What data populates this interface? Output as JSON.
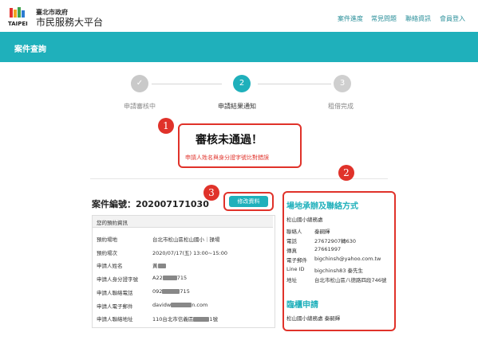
{
  "header": {
    "brand_small": "臺北市政府",
    "brand_big": "市民服務大平台",
    "logo_text": "TAIPEI",
    "nav": [
      "案件進度",
      "常見問題",
      "聯絡資訊",
      "會員登入"
    ]
  },
  "banner": {
    "title": "案件查詢"
  },
  "steps": [
    {
      "num": "✓",
      "label": "申請審核中"
    },
    {
      "num": "2",
      "label": "申請結果通知"
    },
    {
      "num": "3",
      "label": "租借完成"
    }
  ],
  "result": {
    "title": "審核未通過！",
    "reason": "申請人姓名與身分證字號比對錯誤"
  },
  "markers": [
    "1",
    "2",
    "3"
  ],
  "case": {
    "label": "案件編號：202007171030",
    "edit_button": "修改資料",
    "section_title": "您的預約資訊",
    "rows": [
      {
        "k": "預約場地",
        "v": "台北市松山區松山國小｜操場"
      },
      {
        "k": "預約場次",
        "v": "2020/07/17(五) 13:00~15:00"
      },
      {
        "k": "申請人姓名",
        "v": "黃"
      },
      {
        "k": "申請人身分證字號",
        "v": "A22",
        "v2": "715"
      },
      {
        "k": "申請人聯絡電話",
        "v": "092",
        "v2": "715"
      },
      {
        "k": "申請人電子郵件",
        "v": "davidw",
        "v2": "n.com"
      },
      {
        "k": "申請人聯絡地址",
        "v": "110台北市信義區",
        "v2": "1號"
      }
    ]
  },
  "contact": {
    "title": "場地承辦及聯絡方式",
    "org": "松山國小總務處",
    "rows": [
      {
        "k": "聯絡人",
        "v": "秦嗣輝"
      },
      {
        "k": "電話",
        "v": "27672907轉630"
      },
      {
        "k": "傳真",
        "v": "27661997"
      },
      {
        "k": "電子郵件",
        "v": "bigchinsh@yahoo.com.tw"
      },
      {
        "k": "Line ID",
        "v": "bigchinsh83 秦先生"
      },
      {
        "k": "地址",
        "v": "台北市松山區八德路四段746號"
      }
    ],
    "counter_title": "臨櫃申請",
    "counter_text": "松山國小總務處 秦嗣輝"
  },
  "colors": {
    "accent": "#1fb0bb",
    "red": "#e0322a",
    "done": "#c9c9c9",
    "upcoming": "#cfcfcf"
  }
}
